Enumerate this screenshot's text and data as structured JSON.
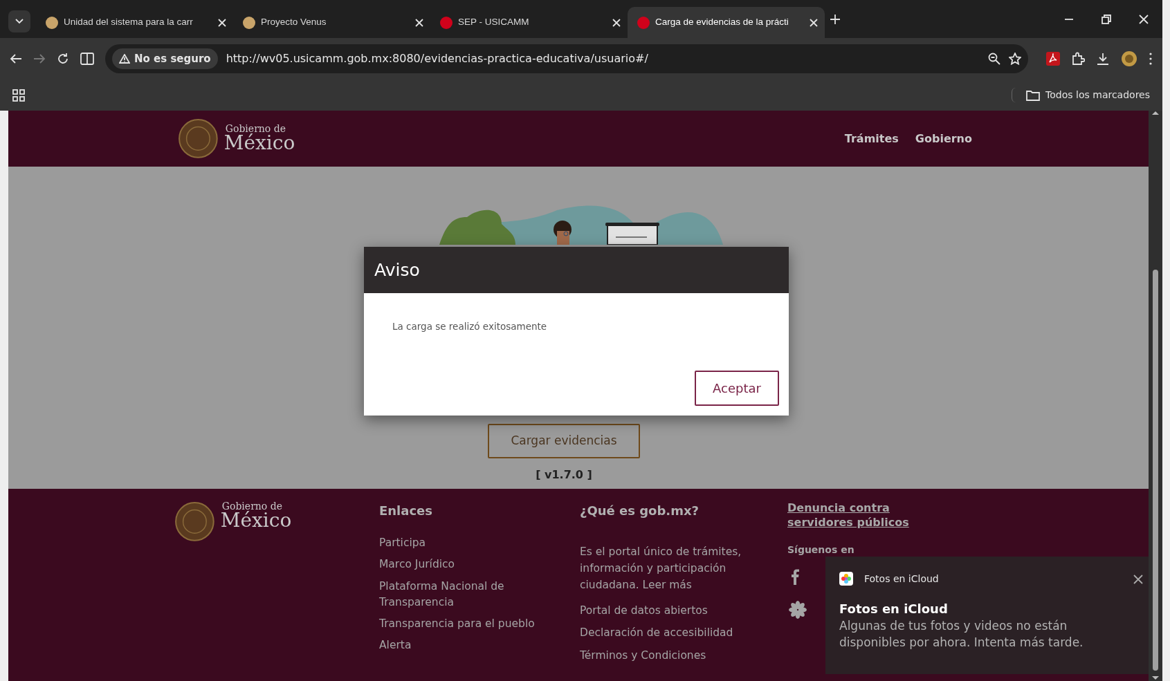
{
  "browser": {
    "tabs": [
      {
        "title": "Unidad del sistema para la carr",
        "selected": false,
        "color": "#c9a46a"
      },
      {
        "title": "Proyecto Venus",
        "selected": false,
        "color": "#c9a46a"
      },
      {
        "title": "SEP - USICAMM",
        "selected": false,
        "color": "#d0021b"
      },
      {
        "title": "Carga de evidencias de la prácti",
        "selected": true,
        "color": "#d0021b"
      }
    ],
    "security": "No es seguro",
    "url": "http://wv05.usicamm.gob.mx:8080/evidencias-practica-educativa/usuario#/",
    "bookmarks_folder": "Todos los marcadores"
  },
  "header": {
    "logo_small": "Gobierno de",
    "logo_big": "México",
    "nav": [
      "Trámites",
      "Gobierno"
    ]
  },
  "main": {
    "cta": "Cargar evidencias",
    "version": "[ v1.7.0 ]"
  },
  "modal": {
    "title": "Aviso",
    "message": "La carga se realizó exitosamente",
    "button": "Aceptar"
  },
  "footer": {
    "logo_small": "Gobierno de",
    "logo_big": "México",
    "links_title": "Enlaces",
    "links": [
      "Participa",
      "Marco Jurídico",
      "Plataforma Nacional de Transparencia",
      "Transparencia para el pueblo",
      "Alerta"
    ],
    "about_title": "¿Qué es gob.mx?",
    "about_text": "Es el portal único de trámites, información y participación ciudadana.",
    "about_link": "Leer más",
    "about_links": [
      "Portal de datos abiertos",
      "Declaración de accesibilidad",
      "Términos y Condiciones"
    ],
    "complaint_link": "Denuncia contra servidores públicos",
    "follow": "Síguenos en"
  },
  "toast": {
    "app": "Fotos en iCloud",
    "title": "Fotos en iCloud",
    "body": "Algunas de tus fotos y videos no están disponibles por ahora. Intenta más tarde."
  }
}
